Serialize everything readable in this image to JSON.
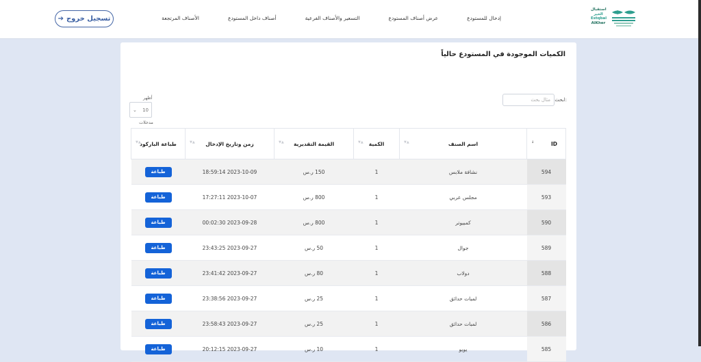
{
  "header": {
    "logo_text_1": "استقبال",
    "logo_text_2": "الخير",
    "logo_text_3": "Estqbal",
    "logo_text_4": "AlKher",
    "logout_label": "تسجيل خروج",
    "nav": [
      "إدخال للمستودع",
      "عرض أصناف المستودع",
      "التسعير والأصناف الفرعية",
      "أصناف داخل المستودع",
      "الأصناف المرتجعة"
    ]
  },
  "page": {
    "title": "الكميات الموجودة في المستودع حالياً",
    "search_label": "ابحث:",
    "search_placeholder": "مثال بحث",
    "length_top": "أظهر",
    "length_value": "10",
    "length_bottom": "مدخلات"
  },
  "table": {
    "headers": [
      "ID",
      "اسم الصنف",
      "الكمية",
      "القيمة التقديرية",
      "زمن وتاريخ الإدخال",
      "طباعة الباركود"
    ],
    "print_label": "طباعة",
    "rows": [
      [
        "594",
        "نشافة ملابس",
        "1",
        "150 ر.س",
        "2023-10-09 18:59:14"
      ],
      [
        "593",
        "مجلس عربي",
        "1",
        "800 ر.س",
        "2023-10-07 17:27:11"
      ],
      [
        "590",
        "كمبيوتر",
        "1",
        "800 ر.س",
        "2023-09-28 00:02:30"
      ],
      [
        "589",
        "جوال",
        "1",
        "50 ر.س",
        "2023-09-27 23:43:25"
      ],
      [
        "588",
        "دولاب",
        "1",
        "80 ر.س",
        "2023-09-27 23:41:42"
      ],
      [
        "587",
        "لمبات حدائق",
        "1",
        "25 ر.س",
        "2023-09-27 23:38:56"
      ],
      [
        "586",
        "لمبات حدائق",
        "1",
        "25 ر.س",
        "2023-09-27 23:58:43"
      ],
      [
        "585",
        "يويو",
        "1",
        "10 ر.س",
        "2023-09-27 20:12:15"
      ]
    ]
  },
  "colors": {
    "accent": "#1463d8",
    "brand_blue": "#3a5fa3",
    "background": "#dfe6f3"
  }
}
